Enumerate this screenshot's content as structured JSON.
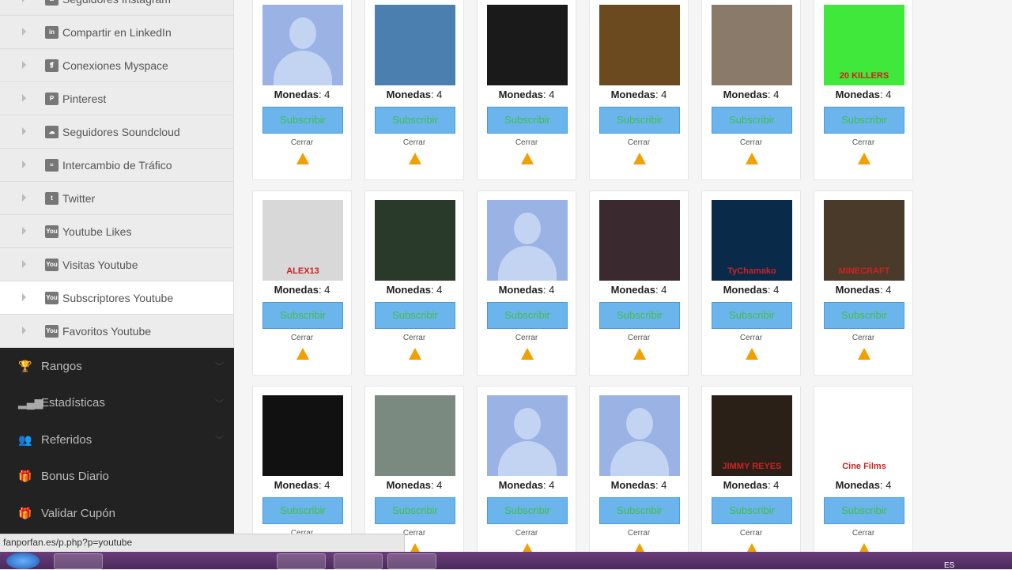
{
  "sidebar": {
    "sub_items": [
      {
        "label": "Seguidores Instagram",
        "icon": "instagram-icon",
        "glyph": "◙"
      },
      {
        "label": "Compartir en LinkedIn",
        "icon": "linkedin-icon",
        "glyph": "in"
      },
      {
        "label": "Conexiones Myspace",
        "icon": "myspace-icon",
        "glyph": "❡"
      },
      {
        "label": "Pinterest",
        "icon": "pinterest-icon",
        "glyph": "P"
      },
      {
        "label": "Seguidores Soundcloud",
        "icon": "soundcloud-icon",
        "glyph": "☁"
      },
      {
        "label": "Intercambio de Tráfico",
        "icon": "rss-icon",
        "glyph": "≈"
      },
      {
        "label": "Twitter",
        "icon": "twitter-icon",
        "glyph": "t"
      },
      {
        "label": "Youtube Likes",
        "icon": "youtube-icon",
        "glyph": "You"
      },
      {
        "label": "Visitas Youtube",
        "icon": "youtube-icon",
        "glyph": "You"
      },
      {
        "label": "Subscriptores Youtube",
        "icon": "youtube-icon",
        "glyph": "You",
        "active": true
      },
      {
        "label": "Favoritos Youtube",
        "icon": "youtube-icon",
        "glyph": "You"
      }
    ],
    "main_items": [
      {
        "label": "Rangos",
        "icon": "trophy-icon",
        "glyph": "🏆",
        "chevron": true
      },
      {
        "label": "Estadísticas",
        "icon": "signal-icon",
        "glyph": "▂▄▆",
        "chevron": true
      },
      {
        "label": "Referidos",
        "icon": "users-icon",
        "glyph": "👥",
        "chevron": true
      },
      {
        "label": "Bonus Diario",
        "icon": "gift-icon",
        "glyph": "🎁",
        "chevron": false
      },
      {
        "label": "Validar Cupón",
        "icon": "gift-icon",
        "glyph": "🎁",
        "chevron": false
      }
    ]
  },
  "cards_common": {
    "coins_label": "Monedas",
    "coins_value": "4",
    "subscribe_label": "Subscribir",
    "close_label": "Cerrar"
  },
  "cards": [
    {
      "image": "default-avatar"
    },
    {
      "image": "tiger",
      "color": "#4a7fb0"
    },
    {
      "image": "magician",
      "color": "#1a1a1a"
    },
    {
      "image": "cat-in-suit",
      "color": "#6b4a20"
    },
    {
      "image": "group-photo",
      "color": "#8a7a6a"
    },
    {
      "image": "20-killers-logo",
      "color": "#3fe83a",
      "text": "20 KILLERS"
    },
    {
      "image": "alex13-logo",
      "color": "#d8d8d8",
      "text": "ALEX13"
    },
    {
      "image": "guitar",
      "color": "#2a3a2a"
    },
    {
      "image": "default-avatar"
    },
    {
      "image": "room-photo",
      "color": "#3a2a30"
    },
    {
      "image": "tychamako",
      "color": "#0a2a4a",
      "text": "TyChamako"
    },
    {
      "image": "minecraft",
      "color": "#4a3a2a",
      "text": "MINECRAFT"
    },
    {
      "image": "pixel-face",
      "color": "#111"
    },
    {
      "image": "tattoo-girl",
      "color": "#7a8a80"
    },
    {
      "image": "default-avatar"
    },
    {
      "image": "default-avatar"
    },
    {
      "image": "jimmy-reyes-poster",
      "color": "#2a2018",
      "text": "JIMMY REYES"
    },
    {
      "image": "cine-films-logo",
      "color": "#ffffff",
      "text": "Cine Films"
    }
  ],
  "status_url": "fanporfan.es/p.php?p=youtube",
  "taskbar": {
    "language": "ES"
  }
}
